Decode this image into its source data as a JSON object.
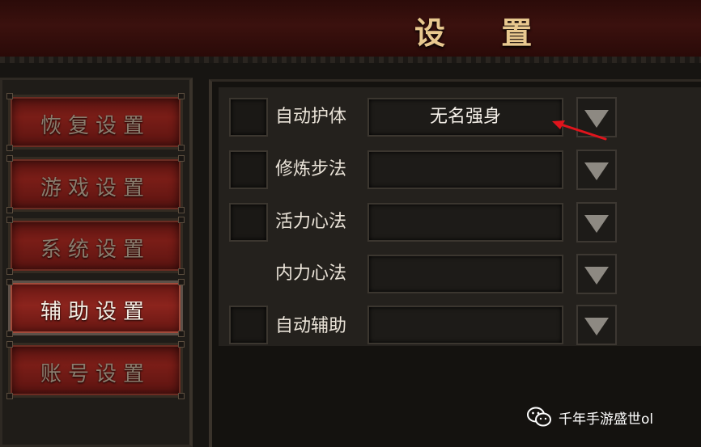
{
  "title": "设 置",
  "sidebar": {
    "items": [
      {
        "label": "恢复设置",
        "active": false
      },
      {
        "label": "游戏设置",
        "active": false
      },
      {
        "label": "系统设置",
        "active": false
      },
      {
        "label": "辅助设置",
        "active": true
      },
      {
        "label": "账号设置",
        "active": false
      }
    ]
  },
  "settings": {
    "rows": [
      {
        "label": "自动护体",
        "value": "无名强身",
        "checkbox": true
      },
      {
        "label": "修炼步法",
        "value": "",
        "checkbox": true
      },
      {
        "label": "活力心法",
        "value": "",
        "checkbox": true
      },
      {
        "label": "内力心法",
        "value": "",
        "checkbox": false
      },
      {
        "label": "自动辅助",
        "value": "",
        "checkbox": true
      }
    ]
  },
  "watermark": {
    "text": "千年手游盛世ol",
    "icon": "wechat-icon"
  },
  "colors": {
    "accent_red": "#7a1d17",
    "title_gold": "#e8c88f",
    "annotation_arrow": "#e0141c"
  }
}
